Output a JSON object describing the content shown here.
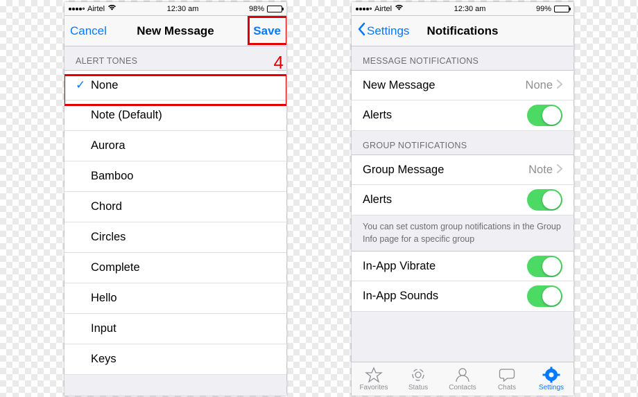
{
  "phone1": {
    "status": {
      "carrier": "Airtel",
      "time": "12:30 am",
      "battery_pct": "98%",
      "battery_fill": 98
    },
    "nav": {
      "cancel": "Cancel",
      "title": "New Message",
      "save": "Save"
    },
    "section_header": "ALERT TONES",
    "annotation_number": "4",
    "tones": [
      {
        "label": "None",
        "selected": true
      },
      {
        "label": "Note (Default)",
        "selected": false
      },
      {
        "label": "Aurora",
        "selected": false
      },
      {
        "label": "Bamboo",
        "selected": false
      },
      {
        "label": "Chord",
        "selected": false
      },
      {
        "label": "Circles",
        "selected": false
      },
      {
        "label": "Complete",
        "selected": false
      },
      {
        "label": "Hello",
        "selected": false
      },
      {
        "label": "Input",
        "selected": false
      },
      {
        "label": "Keys",
        "selected": false
      }
    ]
  },
  "phone2": {
    "status": {
      "carrier": "Airtel",
      "time": "12:30 am",
      "battery_pct": "99%",
      "battery_fill": 99
    },
    "nav": {
      "back": "Settings",
      "title": "Notifications"
    },
    "sections": {
      "message": {
        "header": "MESSAGE NOTIFICATIONS",
        "new_message_label": "New Message",
        "new_message_value": "None",
        "alerts_label": "Alerts",
        "alerts_on": true
      },
      "group": {
        "header": "GROUP NOTIFICATIONS",
        "group_message_label": "Group Message",
        "group_message_value": "Note",
        "alerts_label": "Alerts",
        "alerts_on": true,
        "footer": "You can set custom group notifications in the Group Info page for a specific group"
      },
      "inapp": {
        "vibrate_label": "In-App Vibrate",
        "vibrate_on": true,
        "sounds_label": "In-App Sounds",
        "sounds_on": true
      }
    },
    "tabs": {
      "favorites": "Favorites",
      "status": "Status",
      "contacts": "Contacts",
      "chats": "Chats",
      "settings": "Settings"
    }
  }
}
